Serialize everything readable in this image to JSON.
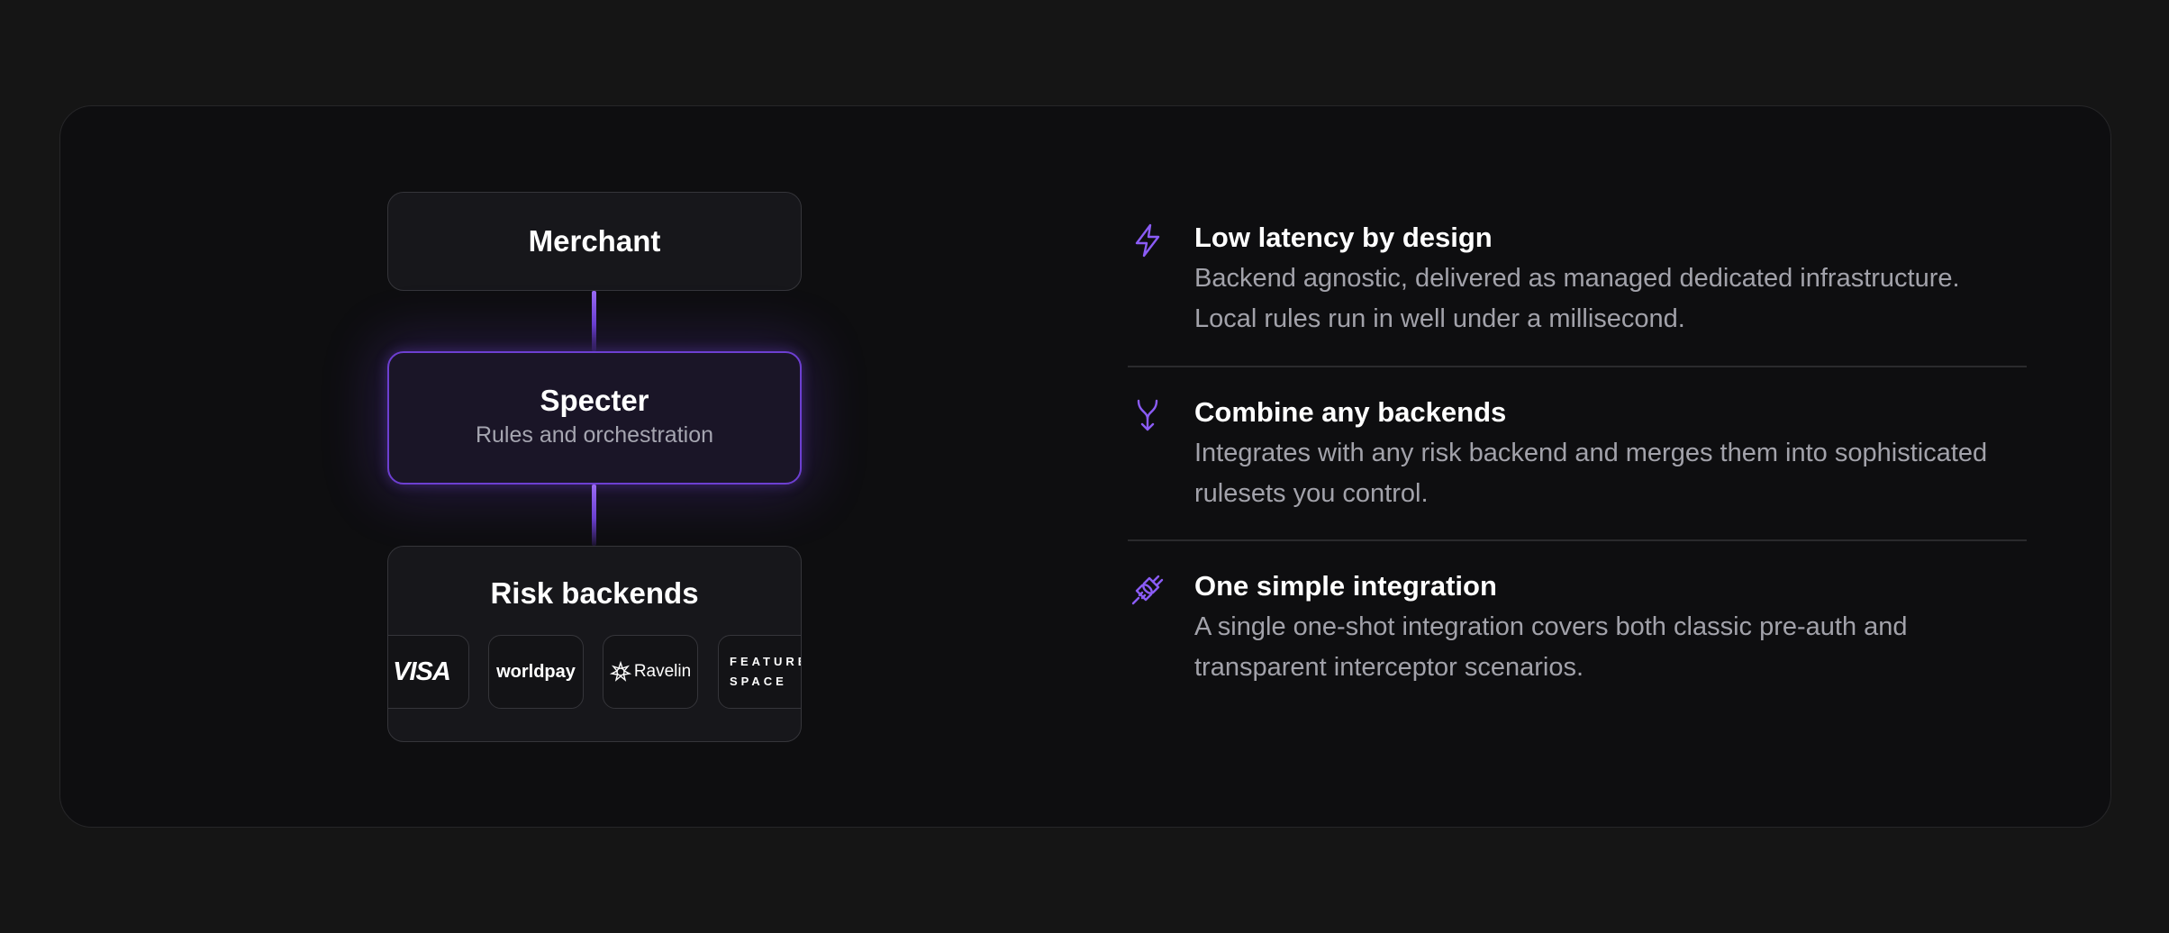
{
  "diagram": {
    "merchant": "Merchant",
    "specter_title": "Specter",
    "specter_subtitle": "Rules and orchestration",
    "risk_title": "Risk backends",
    "logos": [
      "VISA",
      "worldpay",
      "Ravelin",
      "FEATURE\nSPACE"
    ]
  },
  "features": [
    {
      "icon": "lightning-icon",
      "title": "Low latency by design",
      "description": "Backend agnostic, delivered as managed dedicated infrastructure. Local rules run in well under a millisecond."
    },
    {
      "icon": "merge-arrow-icon",
      "title": "Combine any backends",
      "description": "Integrates with any risk backend and merges them into sophisticated rulesets you control."
    },
    {
      "icon": "plug-icon",
      "title": "One simple integration",
      "description": "A single one-shot integration covers both classic pre-auth and transparent interceptor scenarios."
    }
  ],
  "colors": {
    "accent": "#8b5cf6",
    "background": "#151515",
    "card": "#0e0e10",
    "text_primary": "#ffffff",
    "text_secondary": "#a2a2aa"
  }
}
